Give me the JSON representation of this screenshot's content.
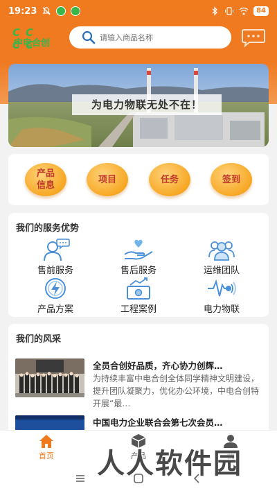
{
  "status_bar": {
    "time": "19:23",
    "battery": "84"
  },
  "header": {
    "logo_cc": "CC CC",
    "logo_text": "中电合创",
    "search_placeholder": "请输入商品名称"
  },
  "banner": {
    "slogan": "为电力物联无处不在！"
  },
  "quick_actions": [
    {
      "label": "产品\n信息"
    },
    {
      "label": "项目"
    },
    {
      "label": "任务"
    },
    {
      "label": "签到"
    }
  ],
  "services": {
    "title": "我们的服务优势",
    "items": [
      {
        "label": "售前服务",
        "icon": "presale-service-icon"
      },
      {
        "label": "售后服务",
        "icon": "aftersale-service-icon"
      },
      {
        "label": "运维团队",
        "icon": "ops-team-icon"
      },
      {
        "label": "产品方案",
        "icon": "product-plan-icon"
      },
      {
        "label": "工程案例",
        "icon": "engineering-case-icon"
      },
      {
        "label": "电力物联",
        "icon": "power-iot-icon"
      }
    ]
  },
  "news": {
    "title": "我们的风采",
    "items": [
      {
        "title": "全员合创好品质，齐心协力创辉…",
        "desc": "为持续丰富中电合创全体同学精神文明建设，提升团队凝聚力，优化办公环境，中电合创特开展“最…"
      },
      {
        "title": "中国电力企业联合会第七次会员…",
        "desc": ""
      }
    ]
  },
  "tabs": [
    {
      "label": "首页",
      "active": true
    },
    {
      "label": "产品",
      "active": false
    },
    {
      "label": "我",
      "active": false
    }
  ],
  "watermark": "人人软件园",
  "colors": {
    "primary": "#f07a1e",
    "accent": "#f7a825",
    "logo_green": "#39b54a",
    "icon_blue": "#4a90d9"
  }
}
